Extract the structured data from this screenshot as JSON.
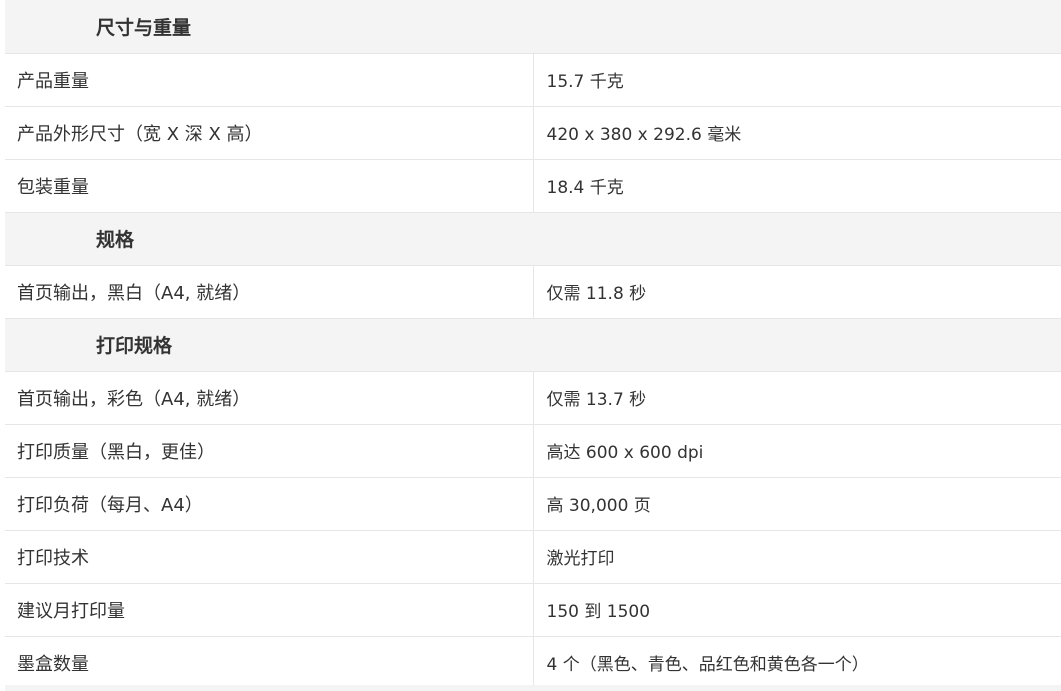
{
  "sections": [
    {
      "title": "尺寸与重量",
      "rows": [
        {
          "label": "产品重量",
          "value": "15.7 千克"
        },
        {
          "label": "产品外形尺寸（宽 X 深 X 高）",
          "value": "420 x 380 x 292.6 毫米"
        },
        {
          "label": "包装重量",
          "value": "18.4 千克"
        }
      ]
    },
    {
      "title": "规格",
      "rows": [
        {
          "label": "首页输出，黑白（A4, 就绪）",
          "value": "仅需 11.8 秒"
        }
      ]
    },
    {
      "title": "打印规格",
      "rows": [
        {
          "label": "首页输出，彩色（A4, 就绪）",
          "value": "仅需 13.7 秒"
        },
        {
          "label": "打印质量（黑白，更佳）",
          "value": "高达 600 x 600 dpi"
        },
        {
          "label": "打印负荷（每月、A4）",
          "value": "高 30,000 页"
        },
        {
          "label": "打印技术",
          "value": "激光打印"
        },
        {
          "label": "建议月打印量",
          "value": "150 到 1500"
        },
        {
          "label": "墨盒数量",
          "value": "4 个（黑色、青色、品红色和黄色各一个）"
        }
      ]
    }
  ]
}
